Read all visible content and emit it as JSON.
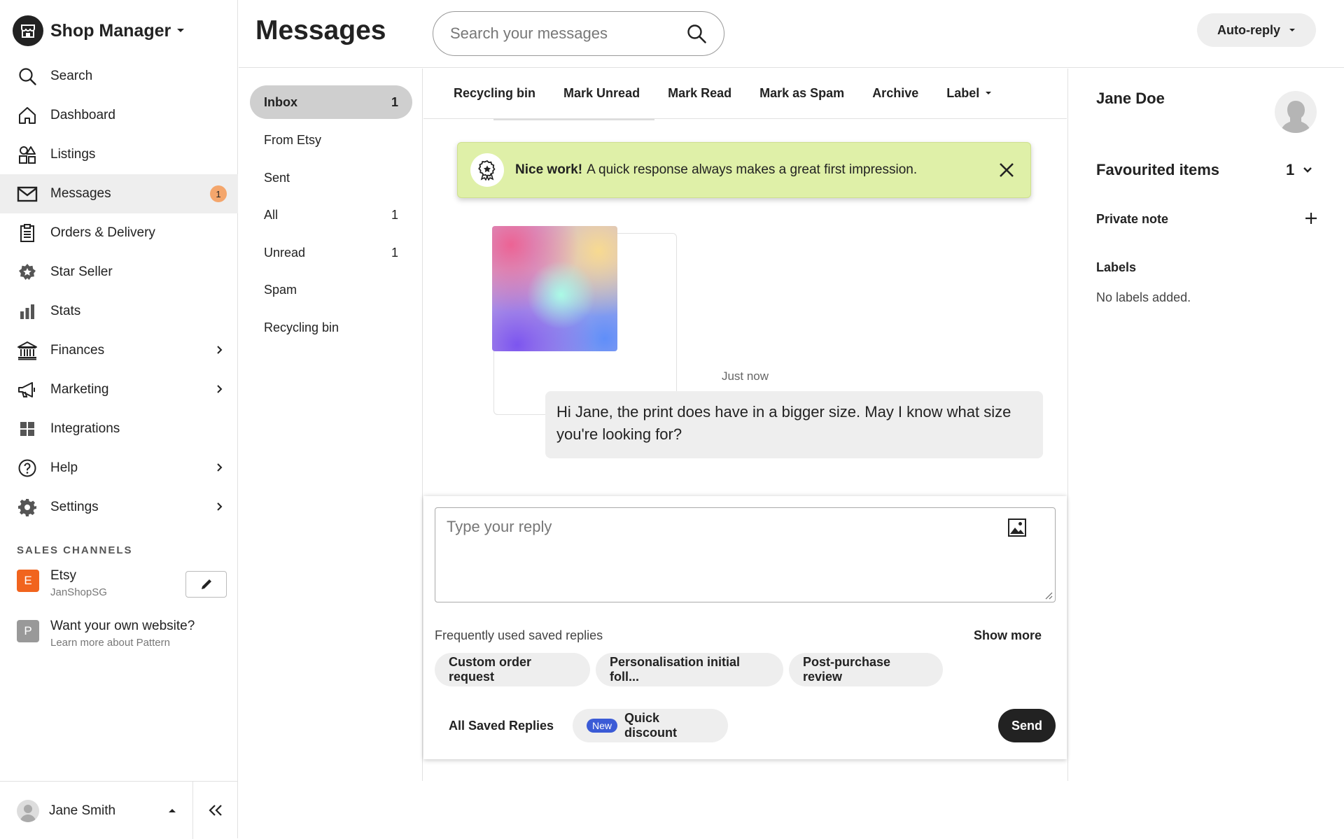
{
  "sidebar": {
    "brand": "Shop Manager",
    "nav": [
      {
        "label": "Search",
        "icon": "search-icon"
      },
      {
        "label": "Dashboard",
        "icon": "home-icon"
      },
      {
        "label": "Listings",
        "icon": "shapes-icon"
      },
      {
        "label": "Messages",
        "icon": "mail-icon",
        "badge": "1",
        "active": true
      },
      {
        "label": "Orders & Delivery",
        "icon": "clipboard-icon"
      },
      {
        "label": "Star Seller",
        "icon": "star-badge-icon"
      },
      {
        "label": "Stats",
        "icon": "bar-chart-icon"
      },
      {
        "label": "Finances",
        "icon": "bank-icon",
        "chevron": true
      },
      {
        "label": "Marketing",
        "icon": "megaphone-icon",
        "chevron": true
      },
      {
        "label": "Integrations",
        "icon": "grid-icon"
      },
      {
        "label": "Help",
        "icon": "help-icon",
        "chevron": true
      },
      {
        "label": "Settings",
        "icon": "gear-icon",
        "chevron": true
      }
    ],
    "sales_channels_title": "SALES CHANNELS",
    "channels": [
      {
        "letter": "E",
        "name": "Etsy",
        "sub": "JanShopSG",
        "color": "#f1641e"
      },
      {
        "letter": "P",
        "name": "Want your own website?",
        "sub": "Learn more about Pattern",
        "color": "#999999"
      }
    ],
    "user": "Jane Smith"
  },
  "header": {
    "title": "Messages",
    "search_placeholder": "Search your messages",
    "autoreply": "Auto-reply"
  },
  "folders": [
    {
      "label": "Inbox",
      "count": "1",
      "active": true
    },
    {
      "label": "From Etsy",
      "count": ""
    },
    {
      "label": "Sent",
      "count": ""
    },
    {
      "label": "All",
      "count": "1"
    },
    {
      "label": "Unread",
      "count": "1"
    },
    {
      "label": "Spam",
      "count": ""
    },
    {
      "label": "Recycling bin",
      "count": ""
    }
  ],
  "toolbar": [
    "Recycling bin",
    "Mark Unread",
    "Mark Read",
    "Mark as Spam",
    "Archive",
    "Label"
  ],
  "toast": {
    "bold": "Nice work!",
    "text": "A quick response always makes a great first impression."
  },
  "thread": {
    "timestamp": "Just now",
    "message": "Hi Jane, the print does have in a bigger size. May I know what size you're looking for?"
  },
  "composer": {
    "placeholder": "Type your reply",
    "saved_label": "Frequently used saved replies",
    "show_more": "Show more",
    "chips": [
      "Custom order request",
      "Personalisation initial foll...",
      "Post-purchase review"
    ],
    "all_saved": "All Saved Replies",
    "new_badge": "New",
    "quick_discount": "Quick discount",
    "send": "Send"
  },
  "details": {
    "name": "Jane Doe",
    "favourited": "Favourited items",
    "favourited_count": "1",
    "private_note": "Private note",
    "labels_title": "Labels",
    "no_labels": "No labels added."
  },
  "colors": {
    "accent": "#222222",
    "toast_bg": "#dff0a8",
    "badge": "#f4a66c",
    "new_badge": "#3b5bd6",
    "etsy": "#f1641e"
  }
}
